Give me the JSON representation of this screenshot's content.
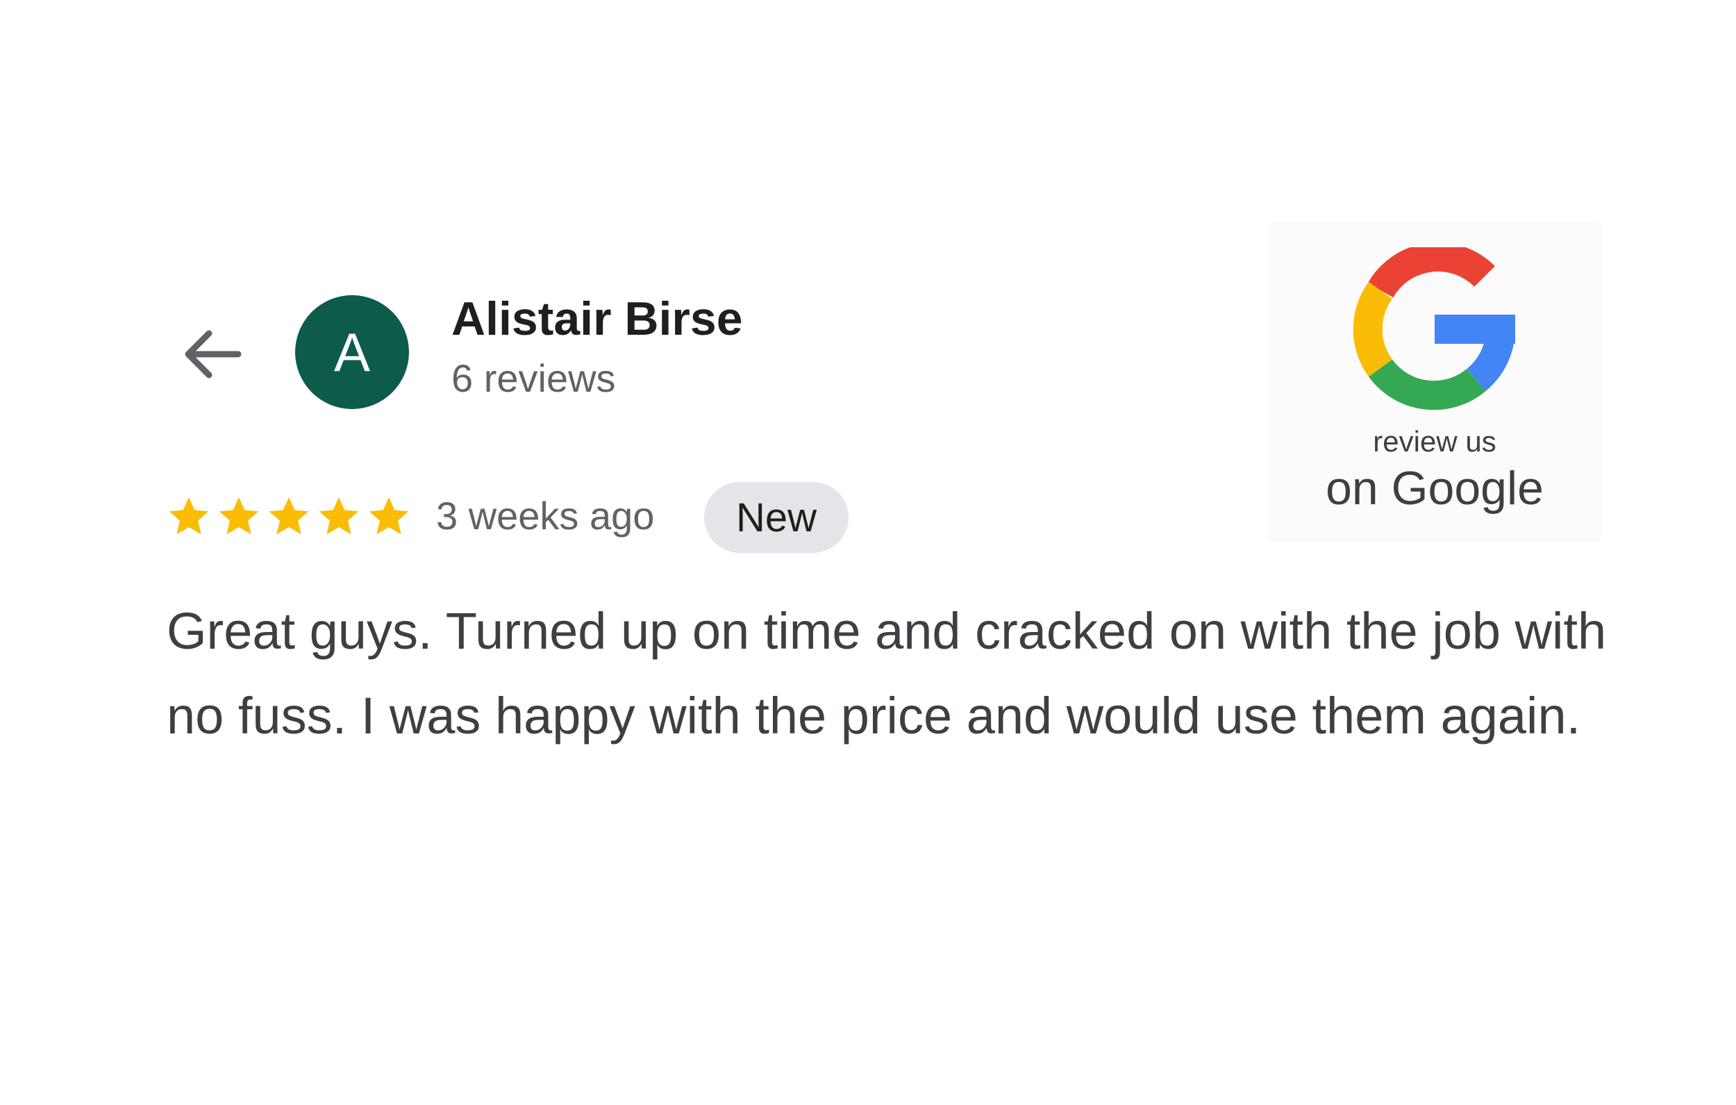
{
  "header": {
    "back_icon": "arrow-left-icon",
    "avatar_initial": "A",
    "avatar_color": "#0d5c4b",
    "reviewer_name": "Alistair Birse",
    "review_count": "6 reviews"
  },
  "review": {
    "rating": 5,
    "max_rating": 5,
    "star_color": "#fbbc04",
    "time_ago": "3 weeks ago",
    "badge": "New",
    "text": "Great guys. Turned up on time and cracked on with the job with no fuss. I was happy with the price and would use them again."
  },
  "google_badge": {
    "logo_icon": "google-g-icon",
    "line1": "review us",
    "line2": "on Google",
    "colors": {
      "red": "#ea4335",
      "yellow": "#fbbc05",
      "green": "#34a853",
      "blue": "#4285f4"
    }
  }
}
